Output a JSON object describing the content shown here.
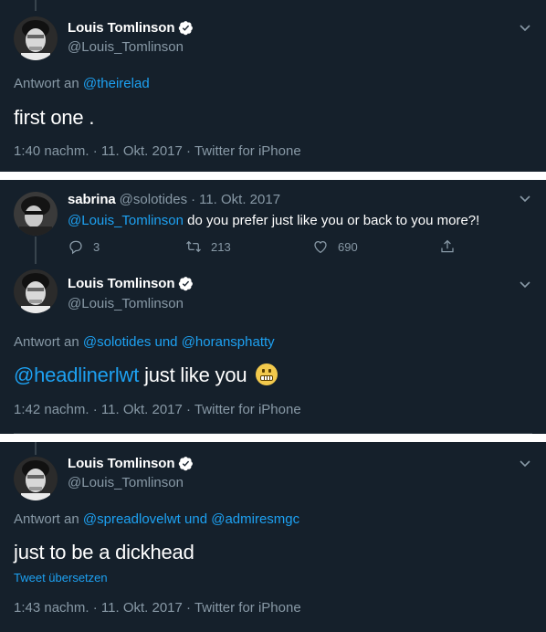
{
  "colors": {
    "background": "#15202b",
    "accent": "#1da1f2",
    "secondary_text": "#8899a6",
    "divider": "#38444d",
    "verified": "#ffffff"
  },
  "tweet1": {
    "name": "Louis Tomlinson",
    "handle": "@Louis_Tomlinson",
    "reply_prefix": "Antwort an",
    "reply_mention": "@theirelad",
    "text": "first one .",
    "time": "1:40 nachm.",
    "date": "11. Okt. 2017",
    "source": "Twitter for iPhone",
    "separator": "·"
  },
  "tweet2": {
    "name": "sabrina",
    "handle": "@solotides",
    "separator": "·",
    "date": "11. Okt. 2017",
    "mention": "@Louis_Tomlinson",
    "text": "do you prefer just like you or back to you more?!",
    "reply_count": "3",
    "retweet_count": "213",
    "like_count": "690"
  },
  "tweet3": {
    "name": "Louis Tomlinson",
    "handle": "@Louis_Tomlinson",
    "reply_prefix": "Antwort an",
    "reply_mention_1": "@solotides",
    "reply_joiner": "und",
    "reply_mention_2": "@horansphatty",
    "mention": "@headlinerlwt",
    "text": "just like you",
    "emoji": "grimacing-face",
    "time": "1:42 nachm.",
    "date": "11. Okt. 2017",
    "source": "Twitter for iPhone",
    "separator": "·"
  },
  "tweet4": {
    "name": "Louis Tomlinson",
    "handle": "@Louis_Tomlinson",
    "reply_prefix": "Antwort an",
    "reply_mention_1": "@spreadlovelwt",
    "reply_joiner": "und",
    "reply_mention_2": "@admiresmgc",
    "text": "just to be a dickhead",
    "translate": "Tweet übersetzen",
    "time": "1:43 nachm.",
    "date": "11. Okt. 2017",
    "source": "Twitter for iPhone",
    "separator": "·"
  }
}
